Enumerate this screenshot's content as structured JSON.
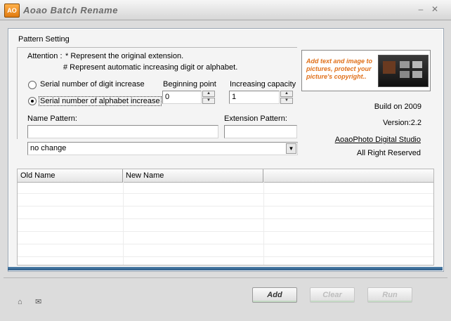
{
  "window": {
    "title": "Aoao Batch Rename"
  },
  "pattern_setting": {
    "group_title": "Pattern Setting",
    "attention_label": "Attention :",
    "attention_line1": "* Represent the original extension.",
    "attention_line2": "# Represent automatic increasing digit or alphabet.",
    "radio_digit": "Serial number of digit increase",
    "radio_alphabet": "Serial number of alphabet increase",
    "selected_radio": "alphabet",
    "beginning_point_label": "Beginning point",
    "beginning_point_value": "0",
    "increasing_capacity_label": "Increasing capacity",
    "increasing_capacity_value": "1",
    "name_pattern_label": "Name Pattern:",
    "name_pattern_value": "",
    "extension_pattern_label": "Extension Pattern:",
    "extension_pattern_value": "",
    "case_select_value": "no change"
  },
  "banner": {
    "text": "Add text and image to pictures, protect your picture's copyright.."
  },
  "info": {
    "build": "Build on 2009",
    "version": "Version:2.2",
    "studio_link": "AoaoPhoto Digital Studio",
    "rights": "All Right Reserved"
  },
  "table": {
    "columns": [
      "Old Name",
      "New Name",
      ""
    ]
  },
  "buttons": {
    "add": "Add",
    "clear": "Clear",
    "run": "Run"
  },
  "icons": {
    "app": "app-logo-icon",
    "home": "home-icon",
    "mail": "mail-icon"
  },
  "colors": {
    "accent_blue": "#2f5b86",
    "banner_orange": "#e0701a"
  }
}
